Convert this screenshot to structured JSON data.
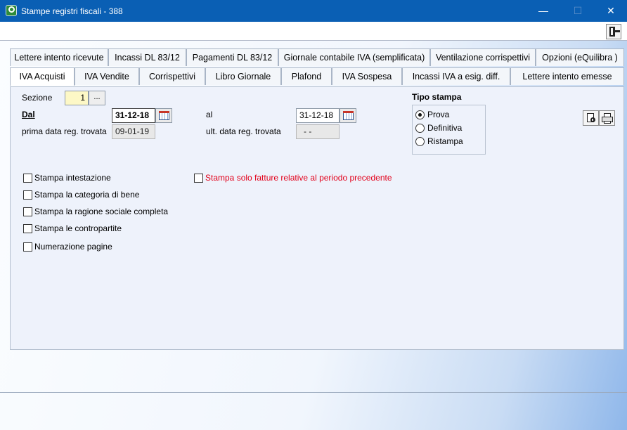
{
  "window": {
    "title": "Stampe registri fiscali - 388",
    "minimize": "—",
    "maximize": "☐",
    "close": "✕"
  },
  "tabs_top": [
    "Lettere intento ricevute",
    "Incassi DL 83/12",
    "Pagamenti DL 83/12",
    "Giornale contabile IVA (semplificata)",
    "Ventilazione corrispettivi",
    "Opzioni (eQuilibra )"
  ],
  "tabs_bottom": [
    "IVA Acquisti",
    "IVA Vendite",
    "Corrispettivi",
    "Libro Giornale",
    "Plafond",
    "IVA Sospesa",
    "Incassi IVA a esig. diff.",
    "Lettere intento emesse"
  ],
  "active_tab": "IVA Acquisti",
  "form": {
    "sezione_label": "Sezione",
    "sezione_value": "1",
    "sezione_btn": "...",
    "dal_label": "Dal",
    "dal_value": "31-12-18",
    "al_label": "al",
    "al_value": "31-12-18",
    "prima_label": "prima data reg. trovata",
    "prima_value": "09-01-19",
    "ult_label": "ult. data reg. trovata",
    "ult_value": "- -"
  },
  "tipo_stampa": {
    "label": "Tipo stampa",
    "options": [
      "Prova",
      "Definitiva",
      "Ristampa"
    ],
    "selected": "Prova"
  },
  "checkboxes": [
    "Stampa intestazione",
    "Stampa la categoria di bene",
    "Stampa la ragione sociale completa",
    "Stampa le contropartite",
    "Numerazione pagine"
  ],
  "checkbox_red": "Stampa solo fatture relative al periodo precedente",
  "colors": {
    "titlebar": "#0a5fb4",
    "red_text": "#e2001a",
    "highlight_field": "#fdf8c6"
  }
}
